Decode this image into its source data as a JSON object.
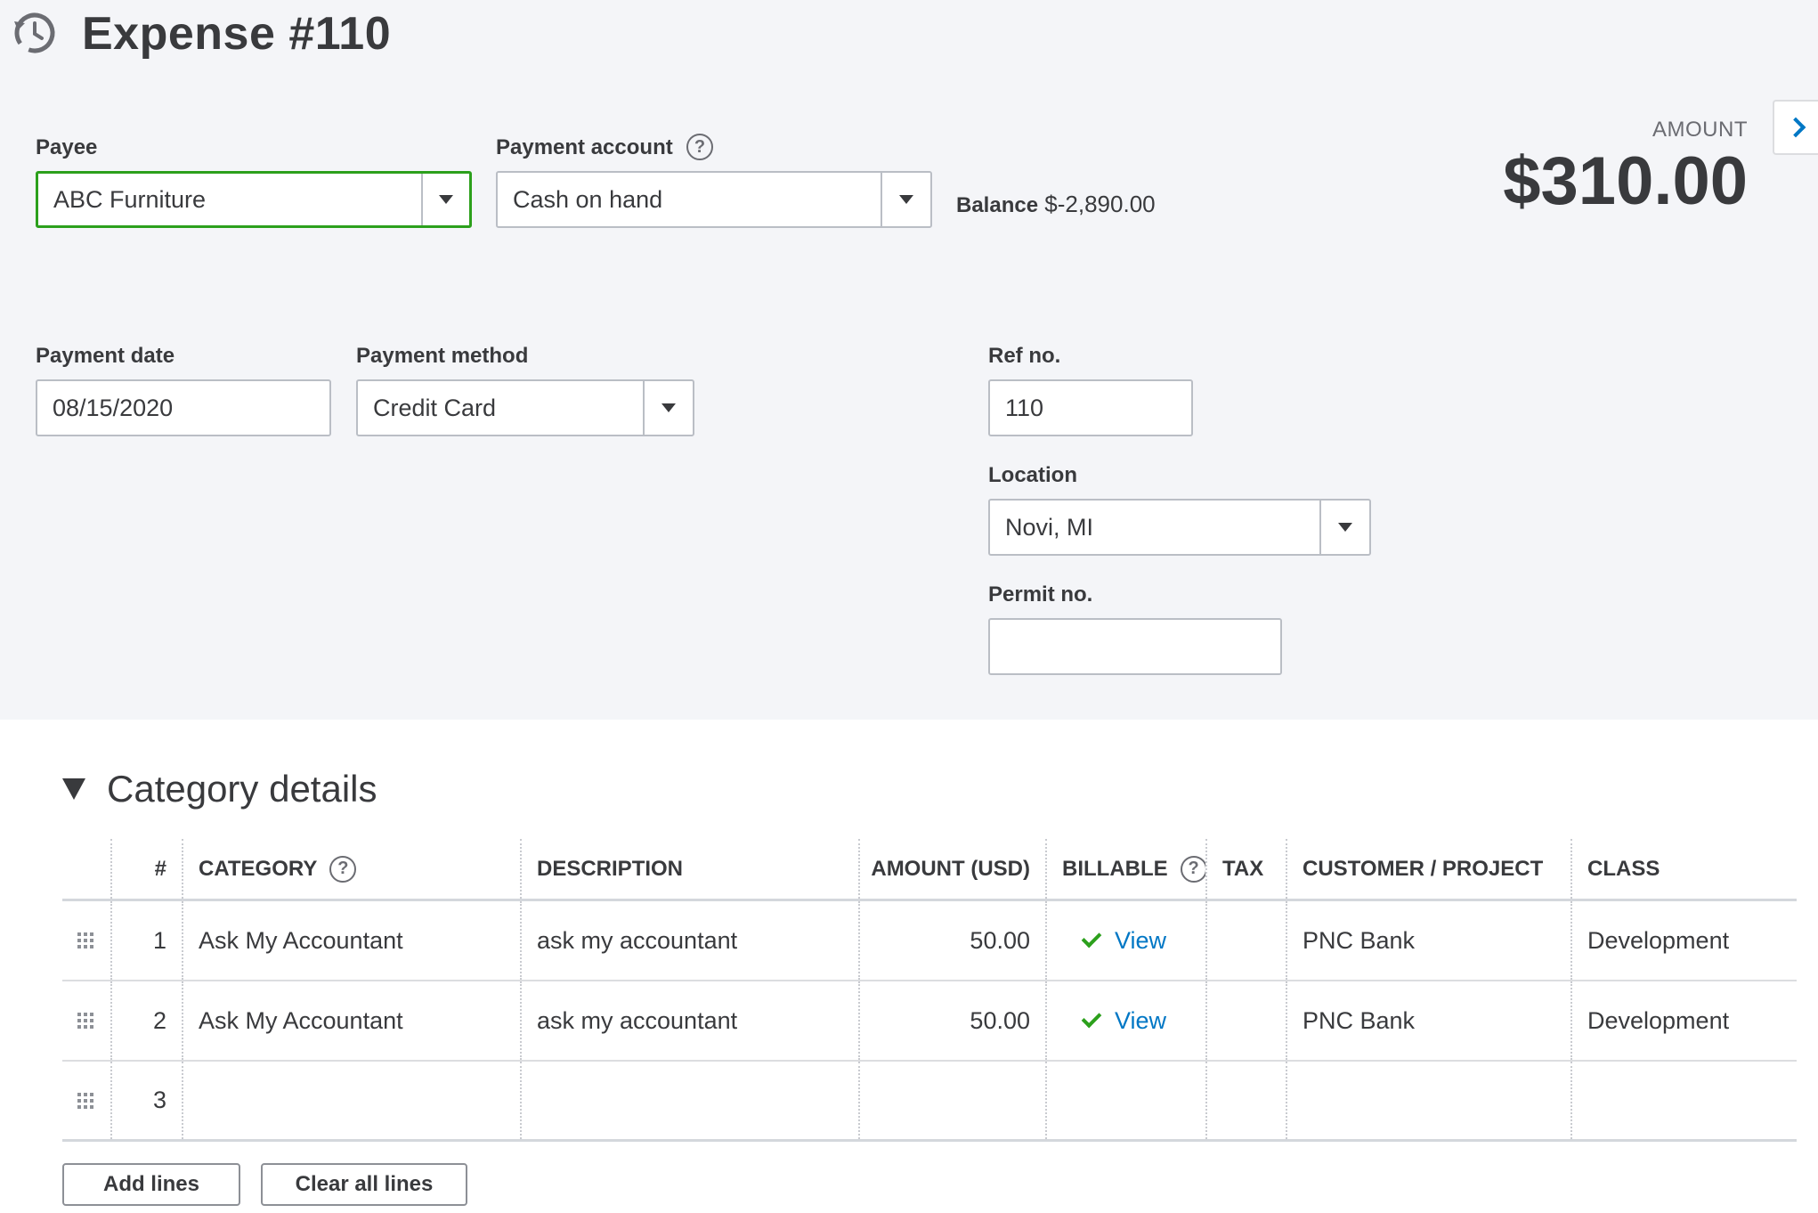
{
  "header": {
    "title": "Expense #110"
  },
  "payee": {
    "label": "Payee",
    "value": "ABC Furniture"
  },
  "payment_account": {
    "label": "Payment account",
    "value": "Cash on hand",
    "help": "?"
  },
  "balance": {
    "label": "Balance",
    "value": "$-2,890.00"
  },
  "amount": {
    "label": "AMOUNT",
    "value": "$310.00"
  },
  "payment_date": {
    "label": "Payment date",
    "value": "08/15/2020"
  },
  "payment_method": {
    "label": "Payment method",
    "value": "Credit Card"
  },
  "ref_no": {
    "label": "Ref no.",
    "value": "110"
  },
  "location": {
    "label": "Location",
    "value": "Novi, MI"
  },
  "permit_no": {
    "label": "Permit no.",
    "value": ""
  },
  "category_details": {
    "title": "Category details",
    "columns": {
      "num": "#",
      "category": "CATEGORY",
      "description": "DESCRIPTION",
      "amount": "AMOUNT (USD)",
      "billable": "BILLABLE",
      "tax": "TAX",
      "customer": "CUSTOMER / PROJECT",
      "class": "CLASS"
    },
    "help": "?",
    "rows": [
      {
        "num": "1",
        "category": "Ask My Accountant",
        "description": "ask my accountant",
        "amount": "50.00",
        "billable_link": "View",
        "tax": "",
        "customer": "PNC Bank",
        "class": "Development"
      },
      {
        "num": "2",
        "category": "Ask My Accountant",
        "description": "ask my accountant",
        "amount": "50.00",
        "billable_link": "View",
        "tax": "",
        "customer": "PNC Bank",
        "class": "Development"
      },
      {
        "num": "3",
        "category": "",
        "description": "",
        "amount": "",
        "billable_link": "",
        "tax": "",
        "customer": "",
        "class": ""
      }
    ]
  },
  "buttons": {
    "add_lines": "Add lines",
    "clear_all_lines": "Clear all lines"
  },
  "icons": {
    "history": "history-clock-icon",
    "expand_panel": "chevron-right-icon",
    "collapse": "triangle-down-icon",
    "drag": "drag-handle-icon",
    "check": "checkmark-icon",
    "dropdown": "caret-down-icon",
    "help": "question-circle-icon"
  },
  "colors": {
    "accent_green": "#2ca01c",
    "link_blue": "#0077c5",
    "panel_bg": "#f4f5f8",
    "text": "#393a3d"
  }
}
